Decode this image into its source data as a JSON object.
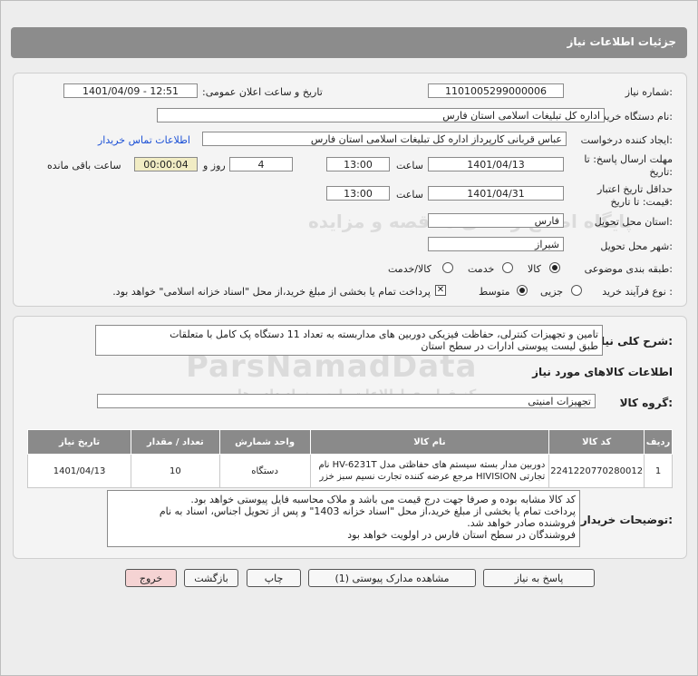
{
  "window_title": "جزئیات اطلاعات نیاز",
  "fields": {
    "need_number_label": "شماره نیاز:",
    "need_number": "1101005299000006",
    "announce_label": "تاریخ و ساعت اعلان عمومی:",
    "announce_value": "1401/04/09 - 12:51",
    "buyer_label": "نام دستگاه خریدار:",
    "buyer_value": "اداره کل تبلیغات اسلامی استان فارس",
    "requester_label": "ایجاد کننده درخواست:",
    "requester_value": "عباس  قربانی کارپرداز اداره کل تبلیغات اسلامی استان فارس",
    "contact_link": "اطلاعات تماس خریدار",
    "deadline_label_1": "مهلت ارسال پاسخ: تا",
    "deadline_label_2": "تاریخ:",
    "deadline_date": "1401/04/13",
    "time_label": "ساعت",
    "deadline_time": "13:00",
    "days_value": "4",
    "days_label": "روز و",
    "remaining_time": "00:00:04",
    "remaining_label": "ساعت باقی مانده",
    "validity_label_1": "حداقل تاریخ اعتبار",
    "validity_label_2": "قیمت: تا تاریخ:",
    "validity_date": "1401/04/31",
    "validity_time": "13:00",
    "province_label": "استان محل تحویل:",
    "province_value": "فارس",
    "city_label": "شهر محل تحویل:",
    "city_value": "شیراز",
    "category_label": "طبقه بندی موضوعی:",
    "cat_goods": "کالا",
    "cat_service": "خدمت",
    "cat_both": "کالا/خدمت",
    "process_label": "نوع فرآیند خرید :",
    "proc_partial": "جزیی",
    "proc_medium": "متوسط",
    "treasury_note": "پرداخت تمام یا بخشی از مبلغ خرید،از محل \"اسناد خزانه اسلامی\" خواهد بود."
  },
  "summary": {
    "label": "شرح کلی نیاز:",
    "line1": "تامین و تجهیزات کنترلی، حفاظت فیزیکی دوربین های مداربسته به تعداد 11 دستگاه پک کامل با متعلقات",
    "line2": "طبق لیست پیوستی ادارات در سطح استان"
  },
  "items_section": {
    "title": "اطلاعات کالاهای مورد نیاز",
    "group_label": "گروه کالا:",
    "group_value": "تجهیزات امنیتی"
  },
  "table": {
    "headers": [
      "ردیف",
      "کد کالا",
      "نام کالا",
      "واحد شمارش",
      "تعداد / مقدار",
      "تاریخ نیاز"
    ],
    "rows": [
      {
        "row": "1",
        "code": "2241220770280012",
        "name_line1": "دوربین مدار بسته سیستم های حفاظتی مدل HV-6231T نام",
        "name_line2": "تجارتی HIVISION مرجع عرضه کننده تجارت نسیم سبز خزر",
        "unit": "دستگاه",
        "qty": "10",
        "date": "1401/04/13"
      }
    ]
  },
  "buyer_notes": {
    "label": "توضیحات خریدار:",
    "line1": "کد کالا مشابه بوده و صرفا جهت درج قیمت می باشد و ملاک محاسبه فایل پیوستی خواهد بود.",
    "line2": "پرداخت تمام یا بخشی از مبلغ خرید،از محل \"اسناد خزانه 1403\" و پس از تحویل اجناس، اسناد به نام",
    "line3": "فروشنده صادر خواهد شد.",
    "line4": "فروشندگان در سطح استان فارس در اولویت خواهد بود"
  },
  "buttons": {
    "reply": "پاسخ به نیاز",
    "view_docs": "مشاهده مدارک پیوستی (1)",
    "print": "چاپ",
    "back": "بازگشت",
    "exit": "خروج"
  },
  "watermark": {
    "main": "ParsNamadData",
    "sub": "مرکز فراوری اطلاعات پارس نماد داده ها",
    "sub2": "پایگاه اطلاع رسانی مناقصه و مزایده"
  },
  "colors": {
    "titlebar": "#8c8c8c",
    "link": "#1a4fd6",
    "exit_button": "#f5d3d3"
  }
}
